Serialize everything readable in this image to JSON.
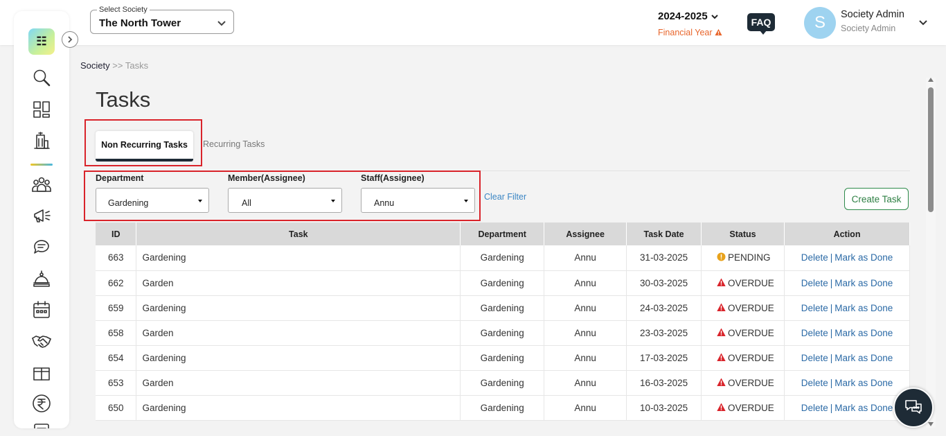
{
  "header": {
    "society_label": "Select Society",
    "society_value": "The North Tower",
    "financial_year": "2024-2025",
    "financial_year_label": "Financial Year",
    "faq": "FAQ",
    "avatar_letter": "S",
    "user_name": "Society Admin",
    "user_role": "Society Admin"
  },
  "sidebar": {
    "logo_glyph": "☷",
    "icons": [
      "search-icon",
      "dashboard-icon",
      "building-icon",
      "members-icon",
      "announcement-icon",
      "chat-icon",
      "service-icon",
      "calendar-icon",
      "handshake-icon",
      "amenity-icon",
      "rupee-icon",
      "document-icon"
    ],
    "active": "building-icon"
  },
  "breadcrumb": {
    "root": "Society",
    "separator": ">>",
    "current": "Tasks"
  },
  "page": {
    "title": "Tasks"
  },
  "tabs": [
    {
      "label": "Non Recurring Tasks",
      "active": true
    },
    {
      "label": "Recurring Tasks",
      "active": false
    }
  ],
  "filters": {
    "department": {
      "label": "Department",
      "value": "Gardening"
    },
    "member": {
      "label": "Member(Assignee)",
      "value": "All"
    },
    "staff": {
      "label": "Staff(Assignee)",
      "value": "Annu"
    },
    "clear": "Clear Filter"
  },
  "create_task": "Create Task",
  "table": {
    "columns": [
      "ID",
      "Task",
      "Department",
      "Assignee",
      "Task Date",
      "Status",
      "Action"
    ],
    "rows": [
      {
        "id": "663",
        "task": "Gardening",
        "department": "Gardening",
        "assignee": "Annu",
        "date": "31-03-2025",
        "status": "PENDING"
      },
      {
        "id": "662",
        "task": "Garden",
        "department": "Gardening",
        "assignee": "Annu",
        "date": "30-03-2025",
        "status": "OVERDUE"
      },
      {
        "id": "659",
        "task": "Gardening",
        "department": "Gardening",
        "assignee": "Annu",
        "date": "24-03-2025",
        "status": "OVERDUE"
      },
      {
        "id": "658",
        "task": "Garden",
        "department": "Gardening",
        "assignee": "Annu",
        "date": "23-03-2025",
        "status": "OVERDUE"
      },
      {
        "id": "654",
        "task": "Gardening",
        "department": "Gardening",
        "assignee": "Annu",
        "date": "17-03-2025",
        "status": "OVERDUE"
      },
      {
        "id": "653",
        "task": "Garden",
        "department": "Gardening",
        "assignee": "Annu",
        "date": "16-03-2025",
        "status": "OVERDUE"
      },
      {
        "id": "650",
        "task": "Gardening",
        "department": "Gardening",
        "assignee": "Annu",
        "date": "10-03-2025",
        "status": "OVERDUE"
      }
    ],
    "action_delete": "Delete",
    "action_separator": "|",
    "action_done": "Mark as Done"
  },
  "colors": {
    "primary_dark": "#1e2b36",
    "pending": "#e8a21b",
    "overdue": "#d9232a",
    "link": "#2b6aa6",
    "highlight": "#d9232a",
    "financial_year": "#e8652b"
  }
}
